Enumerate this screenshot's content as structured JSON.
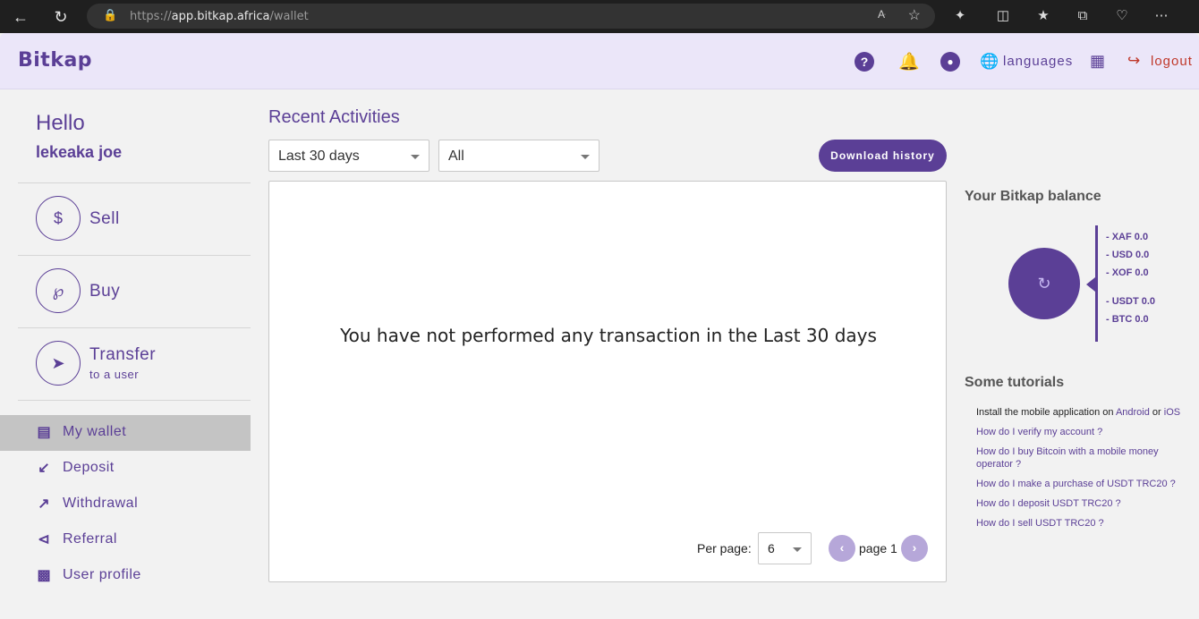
{
  "browser": {
    "url_prefix": "https://",
    "url_host": "app.bitkap.africa",
    "url_path": "/wallet"
  },
  "header": {
    "logo": "Bitkap",
    "languages_label": "languages",
    "logout_label": "logout"
  },
  "greeting": {
    "hello": "Hello",
    "username": "lekeaka joe"
  },
  "actions": [
    {
      "label": "Sell",
      "sub": ""
    },
    {
      "label": "Buy",
      "sub": ""
    },
    {
      "label": "Transfer",
      "sub": "to a user"
    }
  ],
  "menu": [
    {
      "label": "My wallet",
      "icon": "wallet-icon",
      "active": true
    },
    {
      "label": "Deposit",
      "icon": "arrow-down-left-icon",
      "active": false
    },
    {
      "label": "Withdrawal",
      "icon": "arrow-up-right-icon",
      "active": false
    },
    {
      "label": "Referral",
      "icon": "share-icon",
      "active": false
    },
    {
      "label": "User profile",
      "icon": "id-card-icon",
      "active": false
    }
  ],
  "activities": {
    "title": "Recent Activities",
    "period_filter": "Last 30 days",
    "type_filter": "All",
    "download_label": "Download history",
    "empty_message": "You have not performed any transaction in the Last 30 days",
    "per_page_label": "Per page:",
    "per_page_value": "6",
    "page_label": "page 1"
  },
  "balance": {
    "title": "Your Bitkap balance",
    "items": [
      "- XAF 0.0",
      "- USD 0.0",
      "- XOF 0.0",
      "- USDT 0.0",
      "- BTC 0.0"
    ]
  },
  "tutorials": {
    "title": "Some tutorials",
    "install_prefix": "Install the mobile application on",
    "android": "Android",
    "or": "or",
    "ios": "iOS",
    "links": [
      "How do I verify my account ?",
      "How do I buy Bitcoin with a mobile money operator ?",
      "How do I make a purchase of USDT TRC20 ?",
      "How do I deposit USDT TRC20 ?",
      "How do I sell USDT TRC20 ?"
    ]
  },
  "colors": {
    "brand": "#5b3f96",
    "header_bg": "#ebe6f9",
    "logout": "#c0392b"
  }
}
